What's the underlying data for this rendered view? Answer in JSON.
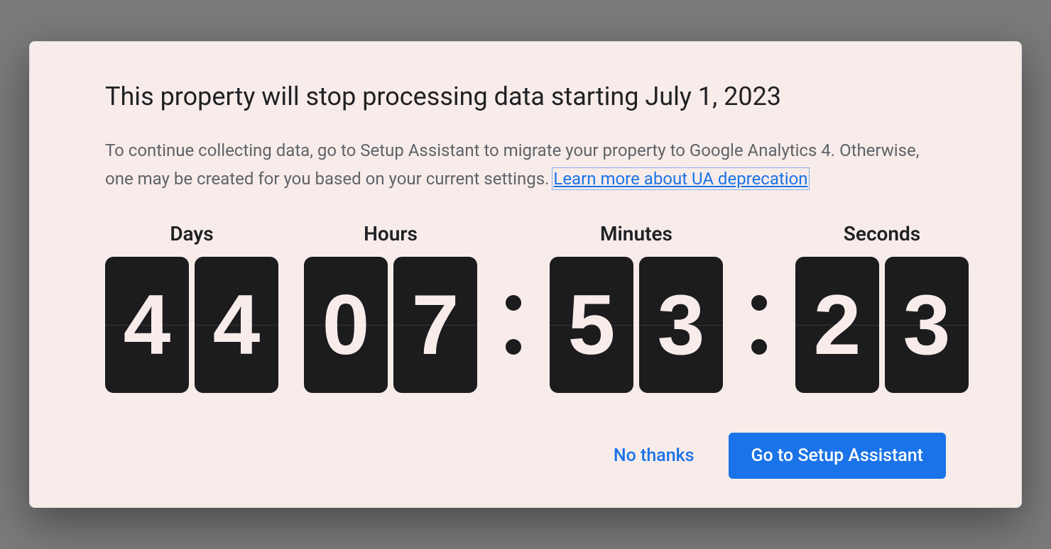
{
  "dialog": {
    "title": "This property will stop processing data starting July 1, 2023",
    "description_before_link": "To continue collecting data, go to Setup Assistant to migrate your property to Google Analytics 4. Otherwise, one may be created for you based on your current settings. ",
    "link_text": "Learn more about UA deprecation"
  },
  "countdown": {
    "days": {
      "label": "Days",
      "d1": "4",
      "d2": "4"
    },
    "hours": {
      "label": "Hours",
      "d1": "0",
      "d2": "7"
    },
    "minutes": {
      "label": "Minutes",
      "d1": "5",
      "d2": "3"
    },
    "seconds": {
      "label": "Seconds",
      "d1": "2",
      "d2": "3"
    }
  },
  "actions": {
    "dismiss": "No thanks",
    "primary": "Go to Setup Assistant"
  }
}
